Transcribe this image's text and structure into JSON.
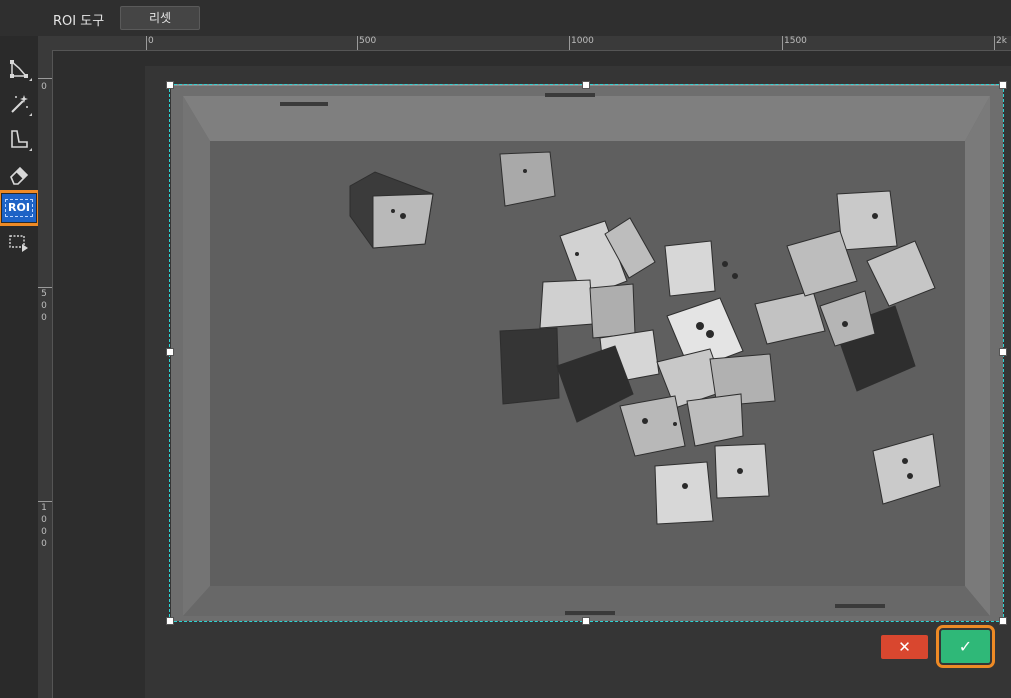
{
  "header": {
    "title": "ROI 도구",
    "reset_label": "리셋"
  },
  "toolbar": {
    "items": [
      {
        "name": "polygon-tool",
        "icon": "polygon-icon"
      },
      {
        "name": "magic-wand-tool",
        "icon": "magic-wand-icon"
      },
      {
        "name": "selection-tool",
        "icon": "selection-icon"
      },
      {
        "name": "eraser-tool",
        "icon": "eraser-icon"
      },
      {
        "name": "roi-tool",
        "icon": "roi-icon",
        "label": "ROI",
        "active": true
      },
      {
        "name": "roi-apply-tool",
        "icon": "roi-play-icon"
      }
    ]
  },
  "ruler": {
    "horizontal_labels": [
      "0",
      "500",
      "1000",
      "1500",
      "2k"
    ],
    "vertical_labels": [
      "0",
      "500",
      "1000"
    ]
  },
  "actions": {
    "cancel_symbol": "✕",
    "confirm_symbol": "✓"
  },
  "colors": {
    "accent_highlight": "#ee8a25",
    "active_tool": "#1e63c6",
    "cancel": "#d9472f",
    "confirm": "#2fb878",
    "roi_border": "#2dd4d4"
  }
}
